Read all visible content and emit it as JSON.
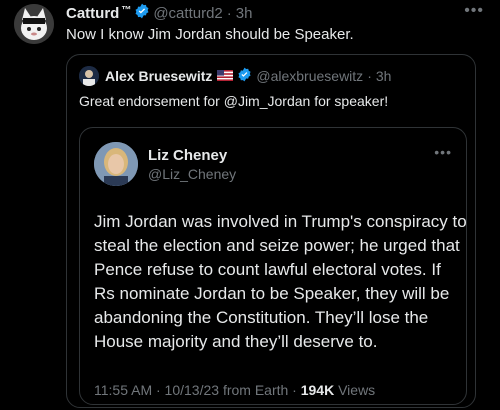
{
  "tweet": {
    "author_name": "Catturd",
    "tm_mark": "™",
    "handle": "@catturd2",
    "separator": "·",
    "time": "3h",
    "more": "•••",
    "text": "Now I know Jim Jordan should be Speaker."
  },
  "quote": {
    "author_name": "Alex Bruesewitz",
    "handle": "@alexbruesewitz",
    "separator": "·",
    "time": "3h",
    "text": "Great endorsement for @Jim_Jordan for speaker!",
    "embedded": {
      "author_name": "Liz Cheney",
      "handle": "@Liz_Cheney",
      "more": "•••",
      "body_lines": [
        "Jim Jordan was involved in Trump's conspiracy to",
        "steal the election and seize power; he urged that",
        "Pence refuse to count lawful electoral votes. If",
        "Rs nominate Jordan to be Speaker, they will be",
        "abandoning the Constitution. They’ll lose the",
        "House majority and they’ll deserve to."
      ],
      "timestamp": "11:55 AM · 10/13/23 from Earth · ",
      "views_count": "194K",
      "views_label": " Views"
    }
  },
  "colors": {
    "background": "#000000",
    "text_primary": "#e7e9ea",
    "text_secondary": "#71767b",
    "border": "#2f3336",
    "verified_blue": "#1d9bf0"
  }
}
